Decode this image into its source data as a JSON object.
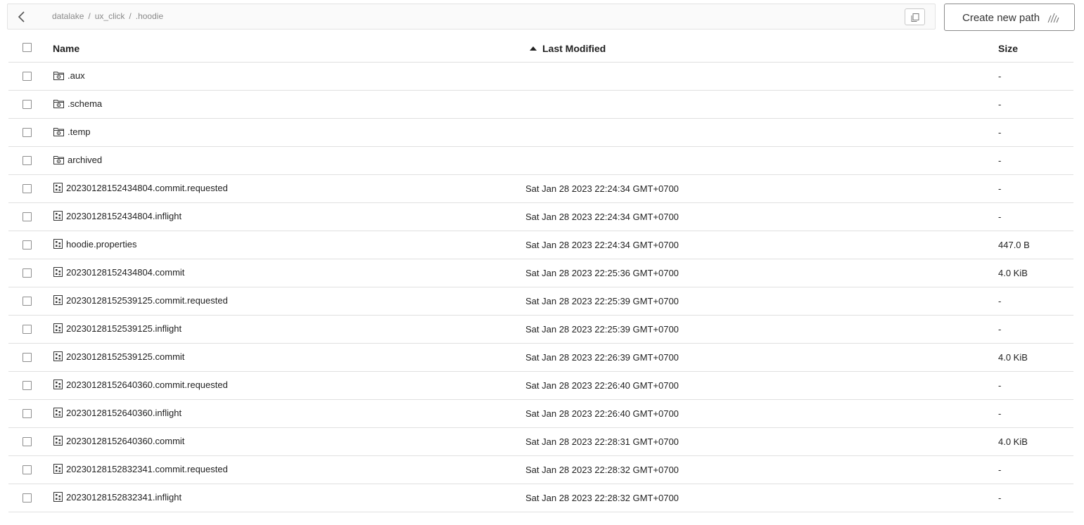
{
  "breadcrumb": {
    "segments": [
      "datalake",
      "ux_click",
      ".hoodie"
    ],
    "separator": "/"
  },
  "toolbar": {
    "create_label": "Create new path"
  },
  "table": {
    "columns": {
      "name": "Name",
      "last_modified": "Last Modified",
      "size": "Size"
    },
    "sort": {
      "column": "last_modified",
      "direction": "ascending"
    },
    "rows": [
      {
        "type": "folder",
        "name": ".aux",
        "modified": "",
        "size": "-"
      },
      {
        "type": "folder",
        "name": ".schema",
        "modified": "",
        "size": "-"
      },
      {
        "type": "folder",
        "name": ".temp",
        "modified": "",
        "size": "-"
      },
      {
        "type": "folder",
        "name": "archived",
        "modified": "",
        "size": "-"
      },
      {
        "type": "file",
        "name": "20230128152434804.commit.requested",
        "modified": "Sat Jan 28 2023 22:24:34 GMT+0700",
        "size": "-"
      },
      {
        "type": "file",
        "name": "20230128152434804.inflight",
        "modified": "Sat Jan 28 2023 22:24:34 GMT+0700",
        "size": "-"
      },
      {
        "type": "file",
        "name": "hoodie.properties",
        "modified": "Sat Jan 28 2023 22:24:34 GMT+0700",
        "size": "447.0 B"
      },
      {
        "type": "file",
        "name": "20230128152434804.commit",
        "modified": "Sat Jan 28 2023 22:25:36 GMT+0700",
        "size": "4.0 KiB"
      },
      {
        "type": "file",
        "name": "20230128152539125.commit.requested",
        "modified": "Sat Jan 28 2023 22:25:39 GMT+0700",
        "size": "-"
      },
      {
        "type": "file",
        "name": "20230128152539125.inflight",
        "modified": "Sat Jan 28 2023 22:25:39 GMT+0700",
        "size": "-"
      },
      {
        "type": "file",
        "name": "20230128152539125.commit",
        "modified": "Sat Jan 28 2023 22:26:39 GMT+0700",
        "size": "4.0 KiB"
      },
      {
        "type": "file",
        "name": "20230128152640360.commit.requested",
        "modified": "Sat Jan 28 2023 22:26:40 GMT+0700",
        "size": "-"
      },
      {
        "type": "file",
        "name": "20230128152640360.inflight",
        "modified": "Sat Jan 28 2023 22:26:40 GMT+0700",
        "size": "-"
      },
      {
        "type": "file",
        "name": "20230128152640360.commit",
        "modified": "Sat Jan 28 2023 22:28:31 GMT+0700",
        "size": "4.0 KiB"
      },
      {
        "type": "file",
        "name": "20230128152832341.commit.requested",
        "modified": "Sat Jan 28 2023 22:28:32 GMT+0700",
        "size": "-"
      },
      {
        "type": "file",
        "name": "20230128152832341.inflight",
        "modified": "Sat Jan 28 2023 22:28:32 GMT+0700",
        "size": "-"
      }
    ]
  },
  "icons": {
    "back": "chevron-left-icon",
    "copy": "copy-icon",
    "create": "path-slashes-icon",
    "folder": "folder-icon",
    "file": "file-icon"
  }
}
